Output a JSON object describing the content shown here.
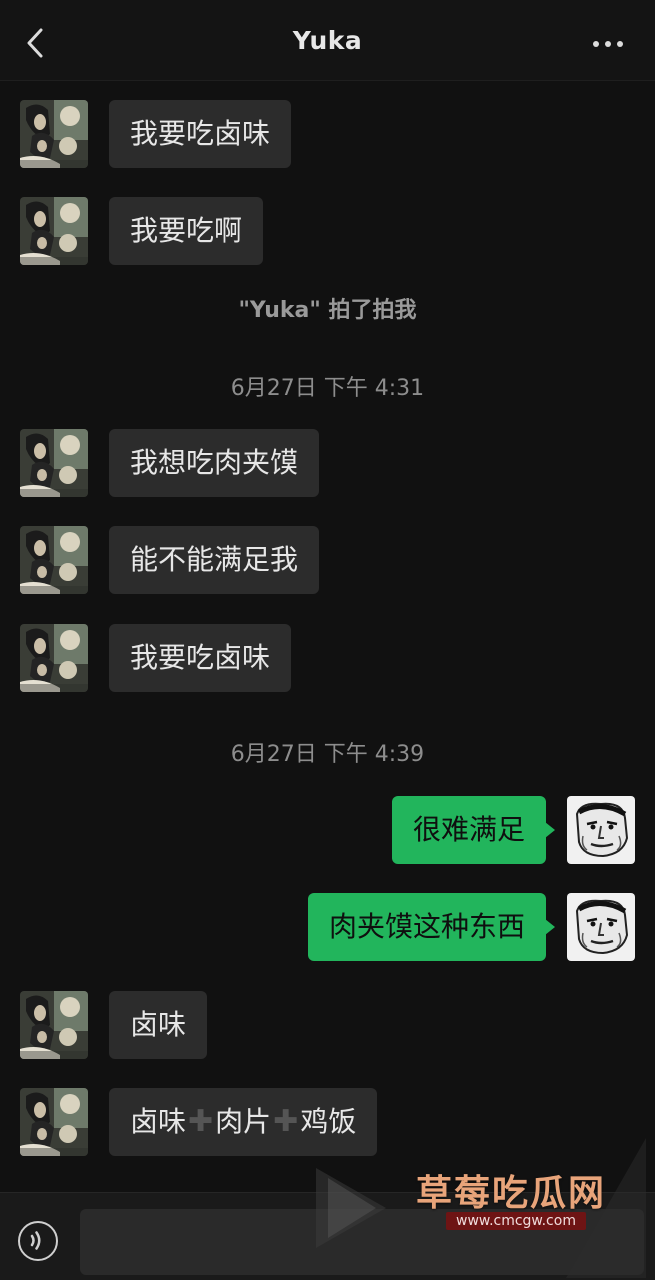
{
  "header": {
    "title": "Yuka",
    "back_icon": "chevron-left-icon",
    "more_icon": "more-icon"
  },
  "messages": [
    {
      "type": "in",
      "text": "我要吃卤味"
    },
    {
      "type": "in",
      "text": "我要吃啊"
    },
    {
      "type": "system",
      "text": "\"Yuka\" 拍了拍我"
    },
    {
      "type": "time",
      "text": "6月27日 下午 4:31"
    },
    {
      "type": "in",
      "text": "我想吃肉夹馍"
    },
    {
      "type": "in",
      "text": "能不能满足我"
    },
    {
      "type": "in",
      "text": "我要吃卤味"
    },
    {
      "type": "time",
      "text": "6月27日 下午 4:39"
    },
    {
      "type": "out",
      "text": "很难满足"
    },
    {
      "type": "out",
      "text": "肉夹馍这种东西"
    },
    {
      "type": "in",
      "text": "卤味"
    },
    {
      "type": "in",
      "parts": [
        "卤味",
        "肉片",
        "鸡饭"
      ]
    }
  ],
  "input_bar": {
    "voice_icon": "voice-icon",
    "text_value": ""
  },
  "watermark": {
    "text": "草莓吃瓜网",
    "url": "www.cmcgw.com"
  },
  "colors": {
    "background": "#111111",
    "incoming_bubble": "#2c2c2c",
    "outgoing_bubble": "#22b55c"
  }
}
